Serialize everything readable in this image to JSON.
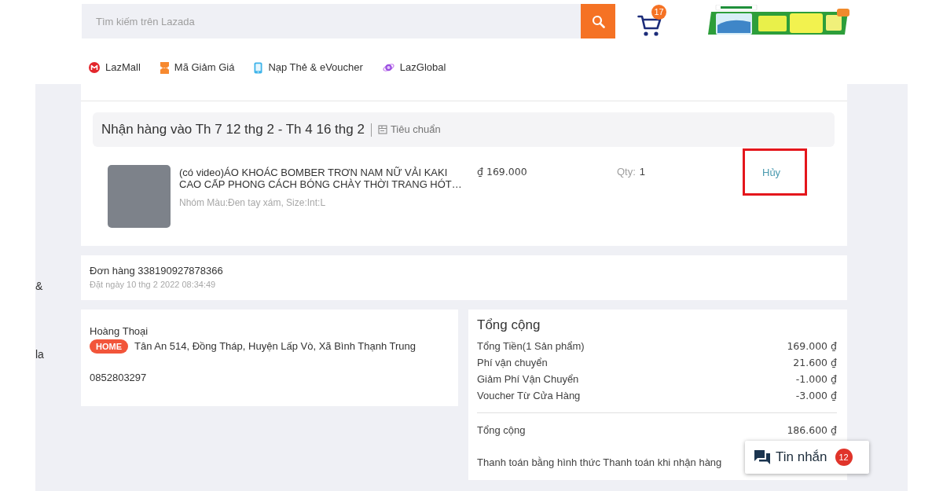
{
  "header": {
    "search": {
      "placeholder": "Tìm kiếm trên Lazada"
    },
    "cart_count": "17"
  },
  "nav_links": [
    {
      "label": "LazMall",
      "kind": "mall"
    },
    {
      "label": "Mã Giảm Giá",
      "kind": "voucher"
    },
    {
      "label": "Nạp Thẻ & eVoucher",
      "kind": "topup"
    },
    {
      "label": "LazGlobal",
      "kind": "global"
    }
  ],
  "sidebar_fragments": [
    "&",
    "la"
  ],
  "package": {
    "delivery": "Nhận hàng vào Th 7 12 thg 2 - Th 4 16 thg 2",
    "shipping_method": "Tiêu chuẩn",
    "item": {
      "title": "(có video)ÁO KHOÁC BOMBER TRƠN NAM NỮ VẢI KAKI CAO CẤP PHONG CÁCH BÓNG CHÀY THỜI TRANG HÓT…",
      "variant": "Nhóm Màu:Đen tay xám, Size:Int:L",
      "price": "₫ 169.000",
      "qty_label": "Qty:",
      "qty": "1",
      "action": "Hủy",
      "highlighted": true
    }
  },
  "order": {
    "number": "Đơn hàng 338190927878366",
    "placed": "Đặt ngày 10 thg 2 2022 08:34:49"
  },
  "address": {
    "name": "Hoàng Thoại",
    "tag": "HOME",
    "address": "Tân An 514, Đồng Tháp, Huyện Lấp Vò, Xã Bình Thạnh Trung",
    "phone": "0852803297"
  },
  "summary": {
    "title": "Tổng cộng",
    "lines": [
      {
        "label": "Tổng Tiền(1 Sản phẩm)",
        "value": "169.000 ₫"
      },
      {
        "label": "Phí vận chuyển",
        "value": "21.600 ₫"
      },
      {
        "label": "Giảm Phí Vận Chuyển",
        "value": "-1.000 ₫"
      },
      {
        "label": "Voucher Từ Cửa Hàng",
        "value": "-3.000 ₫"
      }
    ],
    "total_label": "Tổng cộng",
    "total": "186.600 ₫",
    "payment": "Thanh toán bằng hình thức Thanh toán khi nhận hàng"
  },
  "chat": {
    "label": "Tin nhắn",
    "unread": "12"
  }
}
